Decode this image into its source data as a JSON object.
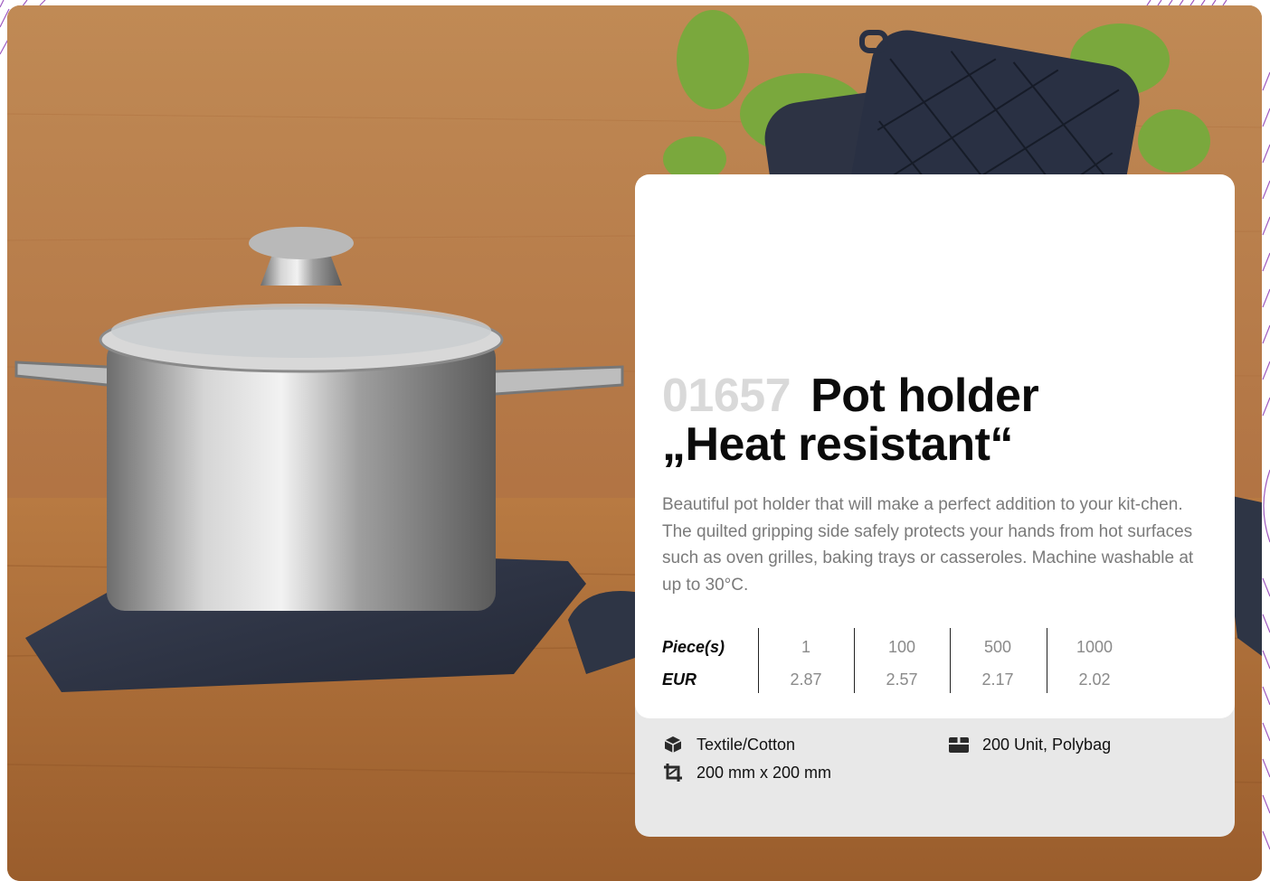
{
  "product": {
    "number": "01657",
    "title_line1": "Pot holder",
    "title_line2": "„Heat resistant“",
    "description": "Beautiful pot holder that will make a perfect addition to your kit-chen. The quilted gripping side safely protects your hands from hot surfaces such as oven grilles, baking trays or casseroles. Machine washable at up to 30°C."
  },
  "pricing": {
    "quantity_label": "Piece(s)",
    "currency_label": "EUR",
    "quantities": [
      "1",
      "100",
      "500",
      "1000"
    ],
    "prices": [
      "2.87",
      "2.57",
      "2.17",
      "2.02"
    ]
  },
  "specs": {
    "material": "Textile/Cotton",
    "dimensions": "200 mm x 200 mm",
    "packaging": "200 Unit, Polybag",
    "material_icon": "box-icon",
    "dimensions_icon": "crop-icon",
    "packaging_icon": "package-icon"
  },
  "colors": {
    "accent": "#8e3fb5",
    "title": "#0b0b0b",
    "number": "#d9d9d9",
    "pot_holder": "#2d3344"
  }
}
